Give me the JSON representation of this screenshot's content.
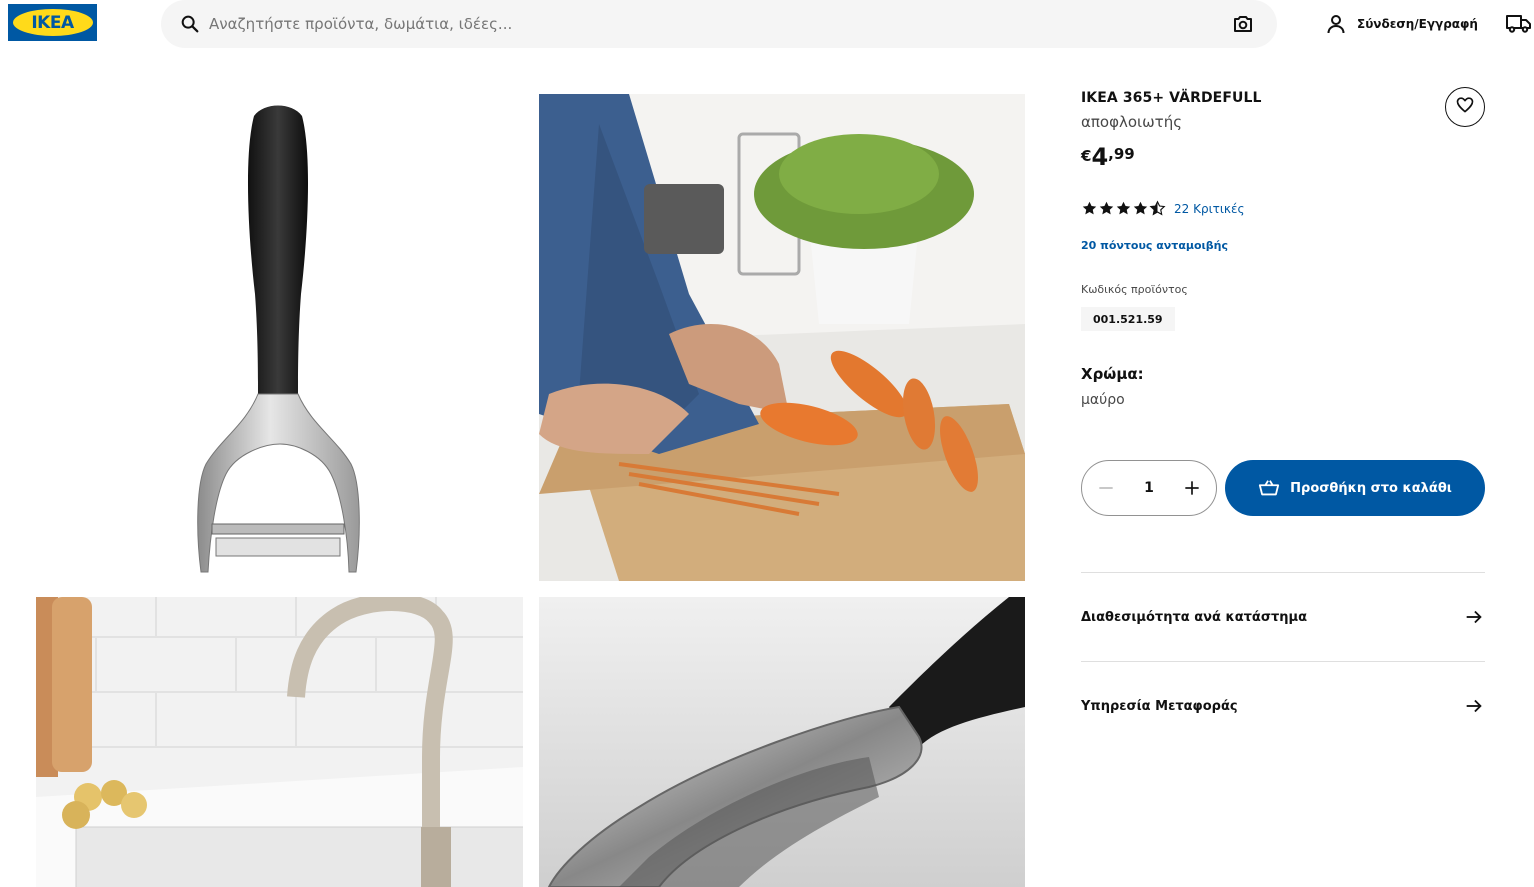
{
  "header": {
    "logo_text": "IKEA",
    "search_placeholder": "Αναζητήστε προϊόντα, δωμάτια, ιδέες...",
    "login_label": "Σύνδεση/Εγγραφή",
    "icons": [
      "search-icon",
      "camera-icon",
      "user-icon",
      "truck-icon"
    ]
  },
  "product": {
    "name": "IKEA 365+ VÄRDEFULL",
    "type": "αποφλοιωτής",
    "price": {
      "currency": "€",
      "integer": "4",
      "decimal": ",99"
    },
    "rating": {
      "stars": 4.5,
      "reviews_label": "22 Κριτικές"
    },
    "rewards": "20 πόντους ανταμοιβής",
    "code_label": "Κωδικός προϊόντος",
    "code": "001.521.59",
    "color_label": "Χρώμα:",
    "color_value": "μαύρο",
    "quantity": "1",
    "add_to_cart_label": "Προσθήκη στο καλάθι",
    "links": [
      {
        "label": "Διαθεσιμότητα ανά κατάστημα"
      },
      {
        "label": "Υπηρεσία Μεταφοράς"
      }
    ]
  },
  "colors": {
    "brand_blue": "#0058a3",
    "brand_yellow": "#ffda1a",
    "text": "#111111",
    "muted": "#484848"
  }
}
